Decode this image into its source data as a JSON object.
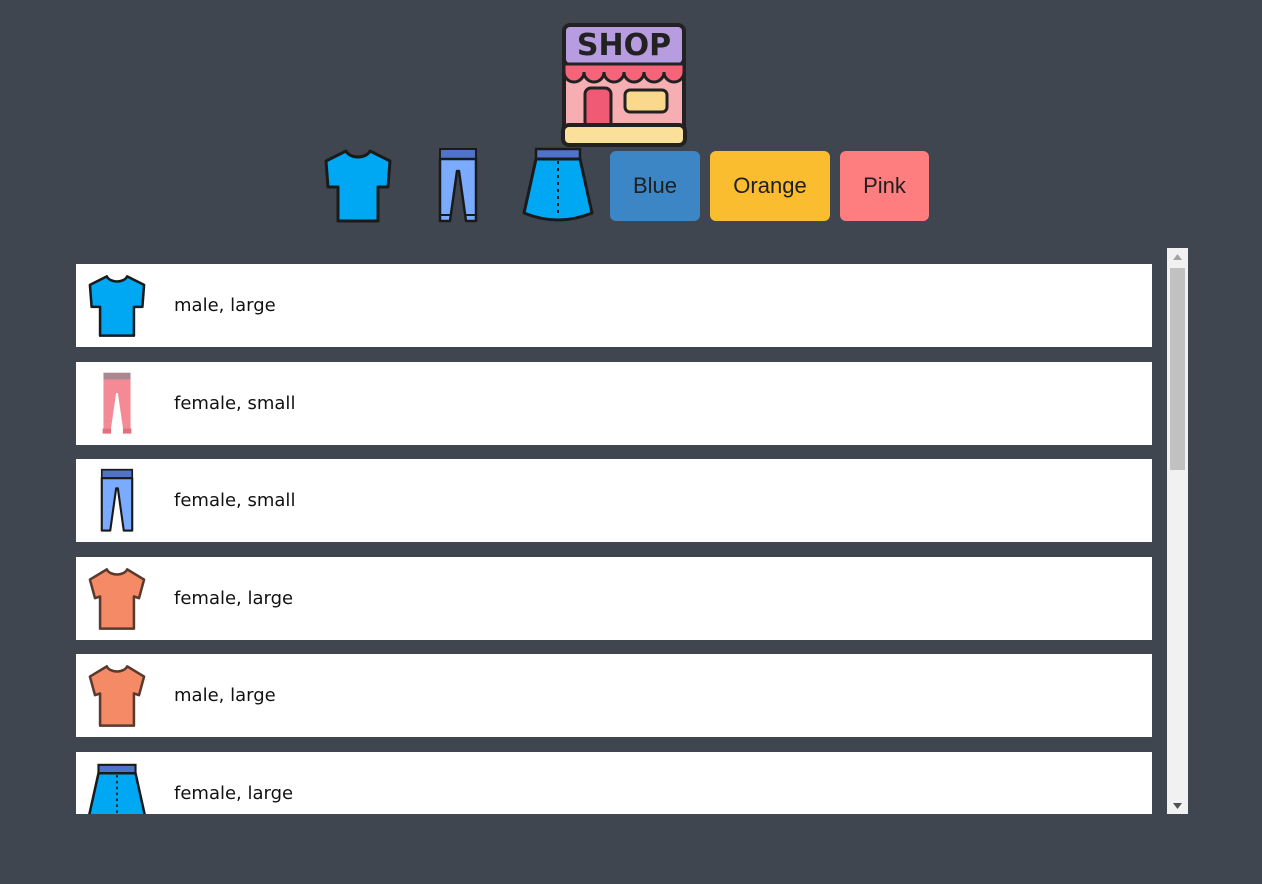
{
  "logo": {
    "label": "SHOP",
    "icon": "shop-storefront-icon"
  },
  "filters": {
    "type_icons": [
      "tshirt-icon",
      "jeans-icon",
      "skirt-icon"
    ],
    "colors": [
      {
        "label": "Blue",
        "color": "#3d86c6"
      },
      {
        "label": "Orange",
        "color": "#fabd2f"
      },
      {
        "label": "Pink",
        "color": "#fe7d7f"
      }
    ]
  },
  "items": [
    {
      "icon": "blue-tshirt-icon",
      "text": "male, large"
    },
    {
      "icon": "pink-pants-icon",
      "text": "female, small"
    },
    {
      "icon": "blue-jeans-icon",
      "text": "female, small"
    },
    {
      "icon": "orange-tshirt-icon",
      "text": "female, large"
    },
    {
      "icon": "orange-tshirt-icon",
      "text": "male, large"
    },
    {
      "icon": "blue-skirt-icon",
      "text": "female, large"
    }
  ]
}
